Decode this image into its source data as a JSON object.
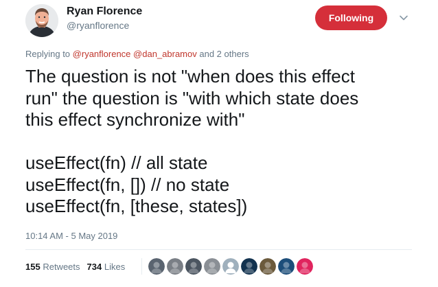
{
  "author": {
    "name": "Ryan Florence",
    "handle": "@ryanflorence",
    "avatar_icon": "avatar-photo-icon"
  },
  "follow_button": {
    "label": "Following",
    "color": "#d52f3a"
  },
  "caret_icon": "chevron-down-icon",
  "reply": {
    "prefix": "Replying to",
    "mention_1": "@ryanflorence",
    "mention_2": "@dan_abramov",
    "suffix": "and 2 others",
    "mention_color": "#c0362c"
  },
  "tweet": {
    "lines": [
      "The question is not \"when does this effect",
      "run\" the question is \"with which state does",
      "this effect synchronize with\"",
      "useEffect(fn) // all state",
      "useEffect(fn, []) // no state",
      "useEffect(fn, [these, states])"
    ]
  },
  "timestamp": "10:14 AM - 5 May 2019",
  "stats": {
    "retweets_count": "155",
    "retweets_label": "Retweets",
    "likes_count": "734",
    "likes_label": "Likes"
  },
  "likers": [
    {
      "icon": "liker-avatar-icon",
      "color": "#5a6470"
    },
    {
      "icon": "liker-avatar-icon",
      "color": "#7a7f86"
    },
    {
      "icon": "liker-avatar-icon",
      "color": "#4b5560"
    },
    {
      "icon": "liker-avatar-icon",
      "color": "#8a8f95"
    },
    {
      "icon": "default-avatar-icon",
      "color": "#9fb0bd"
    },
    {
      "icon": "liker-avatar-icon",
      "color": "#12324f"
    },
    {
      "icon": "liker-avatar-icon",
      "color": "#6b5a3c"
    },
    {
      "icon": "liker-avatar-icon",
      "color": "#1d4e7a"
    },
    {
      "icon": "liker-avatar-icon",
      "color": "#e0245e"
    }
  ]
}
